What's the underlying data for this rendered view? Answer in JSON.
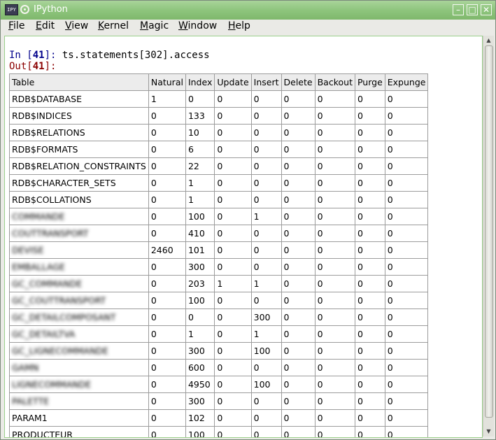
{
  "window": {
    "title": "IPython",
    "app_icon_text": "IPY"
  },
  "window_controls": {
    "minimize": "–",
    "maximize": "□",
    "close": "✕"
  },
  "menu": [
    "File",
    "Edit",
    "View",
    "Kernel",
    "Magic",
    "Window",
    "Help"
  ],
  "console": {
    "in_prefix": "In [",
    "in_number": "41",
    "in_suffix": "]: ",
    "command": "ts.statements[302].access",
    "out_prefix": "Out[",
    "out_number": "41",
    "out_suffix": "]:"
  },
  "table": {
    "headers": [
      "Table",
      "Natural",
      "Index",
      "Update",
      "Insert",
      "Delete",
      "Backout",
      "Purge",
      "Expunge"
    ],
    "rows": [
      [
        "RDB$DATABASE",
        "1",
        "0",
        "0",
        "0",
        "0",
        "0",
        "0",
        "0"
      ],
      [
        "RDB$INDICES",
        "0",
        "133",
        "0",
        "0",
        "0",
        "0",
        "0",
        "0"
      ],
      [
        "RDB$RELATIONS",
        "0",
        "10",
        "0",
        "0",
        "0",
        "0",
        "0",
        "0"
      ],
      [
        "RDB$FORMATS",
        "0",
        "6",
        "0",
        "0",
        "0",
        "0",
        "0",
        "0"
      ],
      [
        "RDB$RELATION_CONSTRAINTS",
        "0",
        "22",
        "0",
        "0",
        "0",
        "0",
        "0",
        "0"
      ],
      [
        "RDB$CHARACTER_SETS",
        "0",
        "1",
        "0",
        "0",
        "0",
        "0",
        "0",
        "0"
      ],
      [
        "RDB$COLLATIONS",
        "0",
        "1",
        "0",
        "0",
        "0",
        "0",
        "0",
        "0"
      ],
      [
        "COMMANDE",
        "0",
        "100",
        "0",
        "1",
        "0",
        "0",
        "0",
        "0"
      ],
      [
        "COUTTRANSPORT",
        "0",
        "410",
        "0",
        "0",
        "0",
        "0",
        "0",
        "0"
      ],
      [
        "DEVISE",
        "2460",
        "101",
        "0",
        "0",
        "0",
        "0",
        "0",
        "0"
      ],
      [
        "EMBALLAGE",
        "0",
        "300",
        "0",
        "0",
        "0",
        "0",
        "0",
        "0"
      ],
      [
        "GC_COMMANDE",
        "0",
        "203",
        "1",
        "1",
        "0",
        "0",
        "0",
        "0"
      ],
      [
        "GC_COUTTRANSPORT",
        "0",
        "100",
        "0",
        "0",
        "0",
        "0",
        "0",
        "0"
      ],
      [
        "GC_DETAILCOMPOSANT",
        "0",
        "0",
        "0",
        "300",
        "0",
        "0",
        "0",
        "0"
      ],
      [
        "GC_DETAILTVA",
        "0",
        "1",
        "0",
        "1",
        "0",
        "0",
        "0",
        "0"
      ],
      [
        "GC_LIGNECOMMANDE",
        "0",
        "300",
        "0",
        "100",
        "0",
        "0",
        "0",
        "0"
      ],
      [
        "GAMN",
        "0",
        "600",
        "0",
        "0",
        "0",
        "0",
        "0",
        "0"
      ],
      [
        "LIGNECOMMANDE",
        "0",
        "4950",
        "0",
        "100",
        "0",
        "0",
        "0",
        "0"
      ],
      [
        "PALETTE",
        "0",
        "300",
        "0",
        "0",
        "0",
        "0",
        "0",
        "0"
      ],
      [
        "PARAM1",
        "0",
        "102",
        "0",
        "0",
        "0",
        "0",
        "0",
        "0"
      ],
      [
        "PRODUCTEUR",
        "0",
        "100",
        "0",
        "0",
        "0",
        "0",
        "0",
        "0"
      ]
    ]
  }
}
